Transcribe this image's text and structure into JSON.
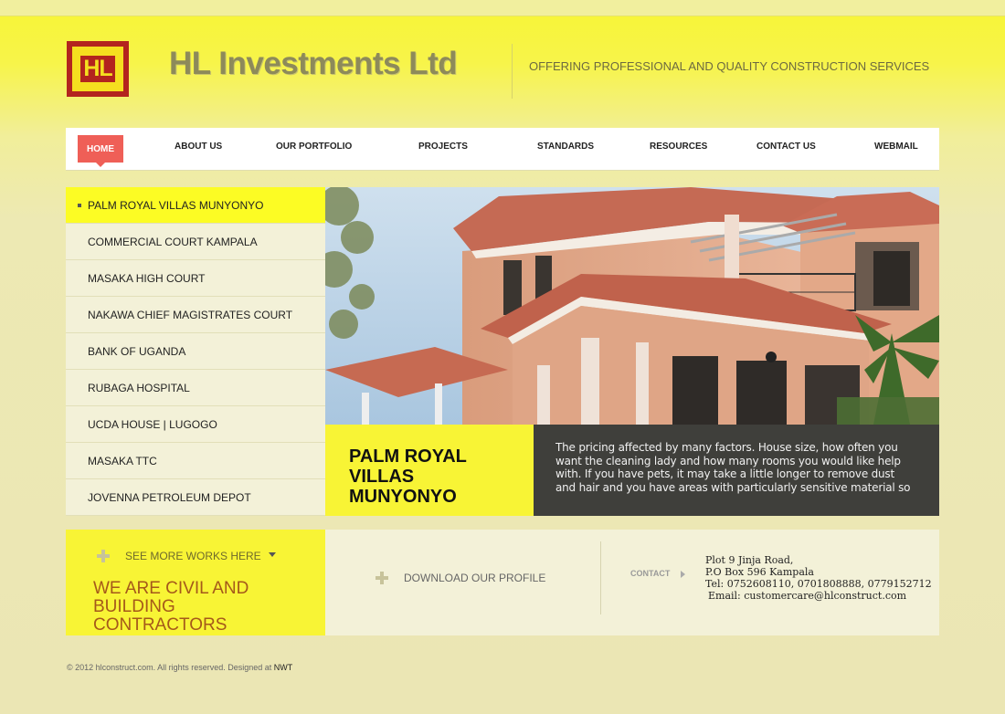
{
  "header": {
    "logo_text": "HL",
    "brand": "HL Investments Ltd",
    "tagline": "OFFERING PROFESSIONAL AND QUALITY CONSTRUCTION SERVICES"
  },
  "nav": {
    "items": [
      "HOME",
      "ABOUT US",
      "OUR PORTFOLIO",
      "PROJECTS",
      "STANDARDS",
      "RESOURCES",
      "CONTACT US",
      "WEBMAIL"
    ],
    "active": "HOME"
  },
  "projects": {
    "items": [
      "PALM ROYAL VILLAS MUNYONYO",
      "COMMERCIAL COURT KAMPALA",
      "MASAKA HIGH COURT",
      "NAKAWA CHIEF MAGISTRATES COURT",
      "BANK OF UGANDA",
      "RUBAGA HOSPITAL",
      "UCDA HOUSE | LUGOGO",
      "MASAKA TTC",
      "JOVENNA PETROLEUM DEPOT"
    ],
    "active_index": 0
  },
  "feature": {
    "title": "PALM ROYAL VILLAS MUNYONYO",
    "description": "The pricing affected by many factors. House size, how often you want the cleaning lady and how many rooms you would like help with. If you have pets, it may take a little longer to remove dust and hair and you have areas with particularly sensitive material so"
  },
  "promo": {
    "see_more": "SEE MORE WORKS HERE",
    "slogan": "WE ARE CIVIL AND BUILDING CONTRACTORS",
    "download": "DOWNLOAD OUR PROFILE"
  },
  "contact": {
    "label": "CONTACT",
    "address1": "Plot 9 Jinja Road,",
    "address2": "P.O Box 596 Kampala",
    "tel": "Tel: 0752608110, 0701808888, 0779152712",
    "email": "Email: customercare@hlconstruct.com"
  },
  "footer": {
    "text": "© 2012 hlconstruct.com. All rights reserved. Designed at",
    "designer": "NWT"
  },
  "colors": {
    "accent_yellow": "#f8f435",
    "home_red": "#ef5f57",
    "logo_red": "#b3241e",
    "dark_caption": "#3f3f3b"
  }
}
